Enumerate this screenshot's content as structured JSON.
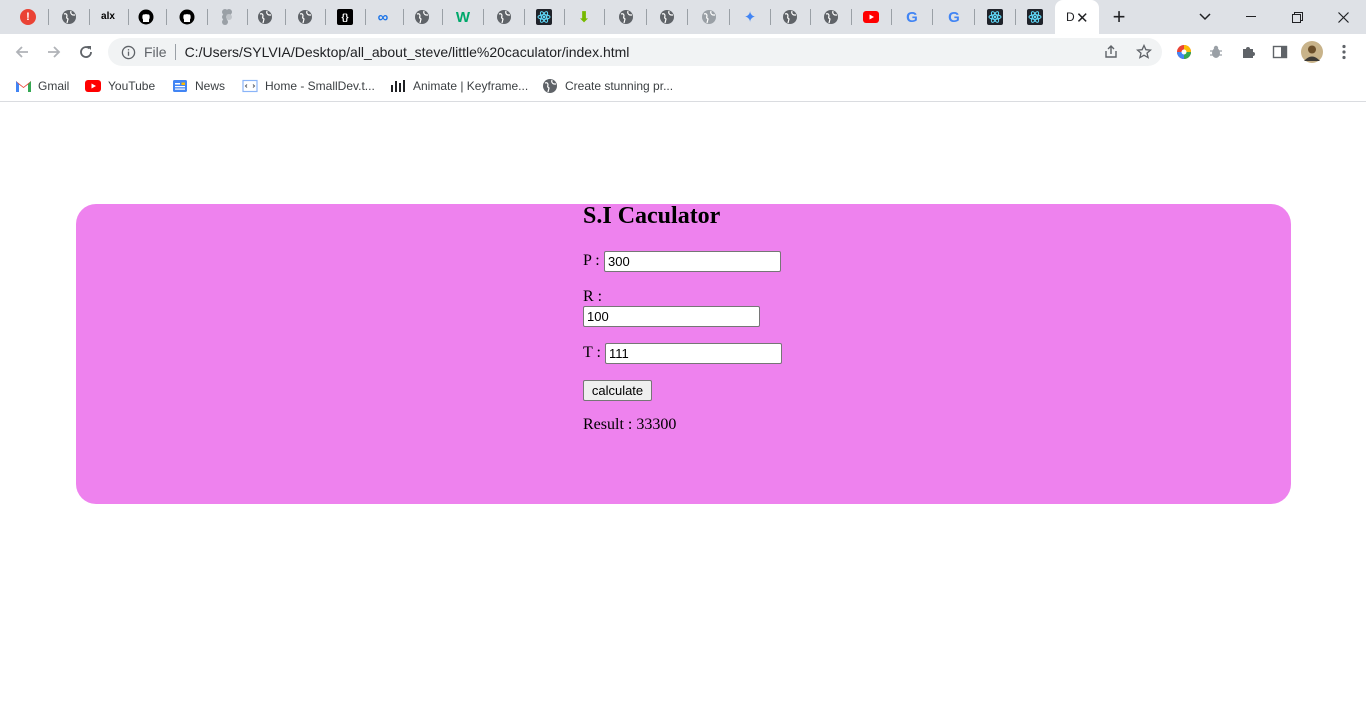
{
  "tabs": [
    {
      "icon": "alert-icon",
      "color": "#ea4335",
      "glyph": "!"
    },
    {
      "icon": "globe-icon",
      "color": "#5f6368",
      "glyph": ""
    },
    {
      "icon": "alx-icon",
      "color": "#000000",
      "glyph": "alx"
    },
    {
      "icon": "github-icon",
      "color": "#000000",
      "glyph": ""
    },
    {
      "icon": "github-icon",
      "color": "#000000",
      "glyph": ""
    },
    {
      "icon": "figma-icon",
      "color": "#9aa0a6",
      "glyph": ""
    },
    {
      "icon": "globe-icon",
      "color": "#5f6368",
      "glyph": ""
    },
    {
      "icon": "globe-icon",
      "color": "#5f6368",
      "glyph": ""
    },
    {
      "icon": "code-icon",
      "color": "#000000",
      "glyph": "{}"
    },
    {
      "icon": "infinity-icon",
      "color": "#1a73e8",
      "glyph": "∞"
    },
    {
      "icon": "globe-icon",
      "color": "#5f6368",
      "glyph": ""
    },
    {
      "icon": "w-icon",
      "color": "#00a86b",
      "glyph": "W"
    },
    {
      "icon": "globe-icon",
      "color": "#5f6368",
      "glyph": ""
    },
    {
      "icon": "react-icon",
      "color": "#222222",
      "glyph": "⚛"
    },
    {
      "icon": "download-icon",
      "color": "#76b900",
      "glyph": "⬇"
    },
    {
      "icon": "globe-icon",
      "color": "#5f6368",
      "glyph": ""
    },
    {
      "icon": "globe-icon",
      "color": "#5f6368",
      "glyph": ""
    },
    {
      "icon": "globe-icon",
      "color": "#9aa0a6",
      "glyph": ""
    },
    {
      "icon": "puzzle-color-icon",
      "color": "#4285f4",
      "glyph": "✦"
    },
    {
      "icon": "globe-icon",
      "color": "#5f6368",
      "glyph": ""
    },
    {
      "icon": "globe-icon",
      "color": "#5f6368",
      "glyph": ""
    },
    {
      "icon": "youtube-icon",
      "color": "#ff0000",
      "glyph": "▶"
    },
    {
      "icon": "google-icon",
      "color": "#4285f4",
      "glyph": "G"
    },
    {
      "icon": "google-icon",
      "color": "#4285f4",
      "glyph": "G"
    },
    {
      "icon": "react-icon",
      "color": "#222222",
      "glyph": "⚛"
    },
    {
      "icon": "react-icon",
      "color": "#222222",
      "glyph": "⚛"
    }
  ],
  "active_tab": {
    "label": "D"
  },
  "toolbar": {
    "file_label": "File",
    "url": "C:/Users/SYLVIA/Desktop/all_about_steve/little%20caculator/index.html"
  },
  "bookmarks": [
    {
      "label": "Gmail",
      "icon": "gmail-icon"
    },
    {
      "label": "YouTube",
      "icon": "youtube-icon"
    },
    {
      "label": "News",
      "icon": "news-icon"
    },
    {
      "label": "Home - SmallDev.t...",
      "icon": "code-page-icon"
    },
    {
      "label": "Animate | Keyframe...",
      "icon": "bars-icon"
    },
    {
      "label": "Create stunning pr...",
      "icon": "globe-icon"
    }
  ],
  "calculator": {
    "title": "S.I Caculator",
    "p_label": "P :",
    "p_value": "300",
    "r_label": "R :",
    "r_value": "100",
    "t_label": "T :",
    "t_value": "111",
    "button_label": "calculate",
    "result_text": "Result : 33300"
  },
  "colors": {
    "card_background": "#ee82ee",
    "tabstrip": "#dee1e6"
  }
}
